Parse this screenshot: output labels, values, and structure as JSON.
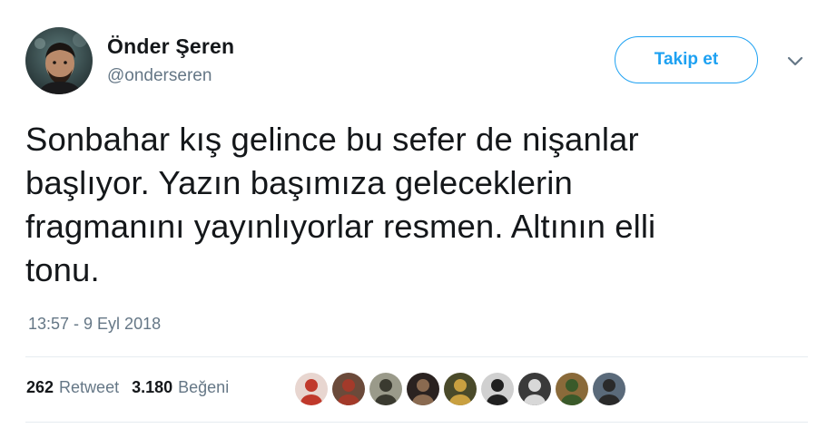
{
  "user": {
    "display_name": "Önder Şeren",
    "handle": "@onderseren"
  },
  "follow_button": {
    "label": "Takip et"
  },
  "tweet": {
    "lines": [
      "Sonbahar kış gelince bu sefer de nişanlar",
      "başlıyor. Yazın başımıza geleceklerin",
      "fragmanını yayınlıyorlar resmen. Altının elli",
      "tonu."
    ],
    "timestamp": "13:57 - 9 Eyl 2018"
  },
  "stats": {
    "retweet_count": "262",
    "retweet_label": "Retweet",
    "like_count": "3.180",
    "like_label": "Beğeni"
  },
  "likers": [
    {
      "name": "liker-avatar-1",
      "bg": "#e8d6d0",
      "fg": "#c0392b"
    },
    {
      "name": "liker-avatar-2",
      "bg": "#6b4a3a",
      "fg": "#a33a2a"
    },
    {
      "name": "liker-avatar-3",
      "bg": "#9a9a8a",
      "fg": "#3a3a30"
    },
    {
      "name": "liker-avatar-4",
      "bg": "#2a2220",
      "fg": "#8a6a50"
    },
    {
      "name": "liker-avatar-5",
      "bg": "#4a4a2a",
      "fg": "#c9a040"
    },
    {
      "name": "liker-avatar-6",
      "bg": "#d0d0d0",
      "fg": "#202020"
    },
    {
      "name": "liker-avatar-7",
      "bg": "#3a3a3a",
      "fg": "#d8d8d8"
    },
    {
      "name": "liker-avatar-8",
      "bg": "#8a6a3a",
      "fg": "#3a5a2a"
    },
    {
      "name": "liker-avatar-9",
      "bg": "#5a6a7a",
      "fg": "#2a2a2a"
    }
  ],
  "colors": {
    "accent": "#1da1f2",
    "text": "#14171a",
    "secondary": "#657786",
    "divider": "#e6ecf0"
  }
}
